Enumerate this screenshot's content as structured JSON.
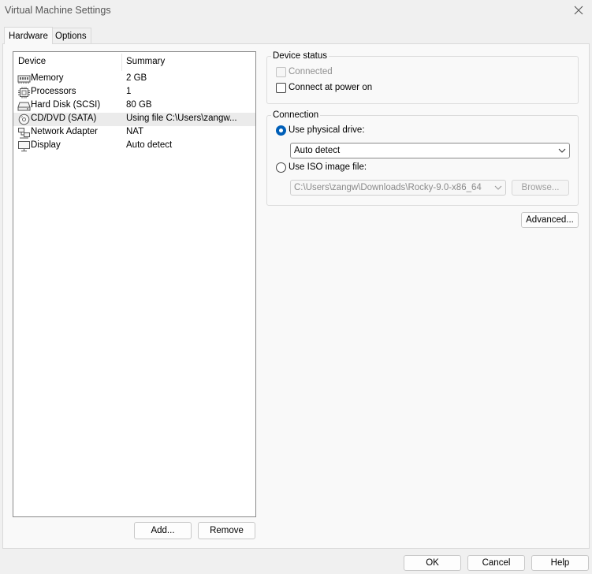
{
  "window": {
    "title": "Virtual Machine Settings"
  },
  "tabs": [
    {
      "label": "Hardware",
      "active": true
    },
    {
      "label": "Options",
      "active": false
    }
  ],
  "device_list": {
    "columns": [
      "Device",
      "Summary"
    ],
    "rows": [
      {
        "icon": "memory-icon",
        "device": "Memory",
        "summary": "2 GB"
      },
      {
        "icon": "processor-icon",
        "device": "Processors",
        "summary": "1"
      },
      {
        "icon": "hard-disk-icon",
        "device": "Hard Disk (SCSI)",
        "summary": "80 GB"
      },
      {
        "icon": "cd-dvd-icon",
        "device": "CD/DVD (SATA)",
        "summary": "Using file C:\\Users\\zangw...",
        "selected": true
      },
      {
        "icon": "network-adapter-icon",
        "device": "Network Adapter",
        "summary": "NAT"
      },
      {
        "icon": "display-icon",
        "device": "Display",
        "summary": "Auto detect"
      }
    ]
  },
  "list_buttons": {
    "add": "Add...",
    "remove": "Remove"
  },
  "device_status": {
    "label": "Device status",
    "connected": {
      "label": "Connected",
      "checked": false,
      "enabled": false
    },
    "connect_at_power_on": {
      "label": "Connect at power on",
      "checked": false,
      "enabled": true
    }
  },
  "connection": {
    "label": "Connection",
    "physical_drive": {
      "label": "Use physical drive:",
      "selected": true,
      "value": "Auto detect"
    },
    "iso_image": {
      "label": "Use ISO image file:",
      "selected": false,
      "value": "C:\\Users\\zangw\\Downloads\\Rocky-9.0-x86_64",
      "browse": "Browse..."
    }
  },
  "advanced_button": "Advanced...",
  "footer": {
    "ok": "OK",
    "cancel": "Cancel",
    "help": "Help"
  },
  "colors": {
    "accent": "#005fb8",
    "window_bg": "#f0f0f0",
    "panel_bg": "#f9f9f9"
  }
}
